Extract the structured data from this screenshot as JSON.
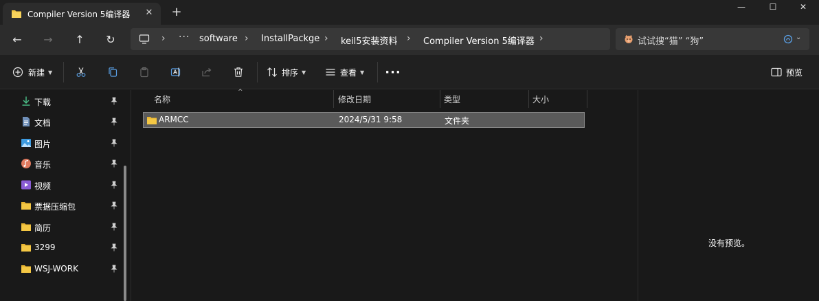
{
  "tab": {
    "title": "Compiler Version 5编译器",
    "close": "✕",
    "new_tab": "+"
  },
  "window": {
    "minimize": "—",
    "maximize": "☐",
    "close": "✕"
  },
  "nav": {
    "back": "←",
    "forward": "→",
    "up": "↑",
    "refresh": "↻"
  },
  "address": {
    "more": "···",
    "separator": "›",
    "crumbs": [
      "software",
      "InstallPackge",
      "keil5安装资料",
      "Compiler Version 5编译器"
    ]
  },
  "search": {
    "placeholder": "试试搜“猫” “狗”"
  },
  "toolbar": {
    "new_label": "新建",
    "sort_label": "排序",
    "view_label": "查看",
    "more": "···",
    "preview_label": "预览"
  },
  "sidebar": {
    "items": [
      {
        "label": "下载",
        "icon": "download-icon"
      },
      {
        "label": "文档",
        "icon": "document-icon"
      },
      {
        "label": "图片",
        "icon": "pictures-icon"
      },
      {
        "label": "音乐",
        "icon": "music-icon"
      },
      {
        "label": "视频",
        "icon": "video-icon"
      },
      {
        "label": "票据压缩包",
        "icon": "folder-icon"
      },
      {
        "label": "简历",
        "icon": "folder-icon"
      },
      {
        "label": "3299",
        "icon": "folder-icon"
      },
      {
        "label": "WSJ-WORK",
        "icon": "folder-icon"
      }
    ]
  },
  "columns": {
    "name": "名称",
    "modified": "修改日期",
    "type": "类型",
    "size": "大小"
  },
  "files": [
    {
      "name": "ARMCC",
      "modified": "2024/5/31 9:58",
      "type": "文件夹",
      "size": ""
    }
  ],
  "preview": {
    "empty_text": "没有预览。"
  },
  "colors": {
    "accent_folder": "#f4c744",
    "selection": "#5a5a5a",
    "background": "#191919"
  }
}
